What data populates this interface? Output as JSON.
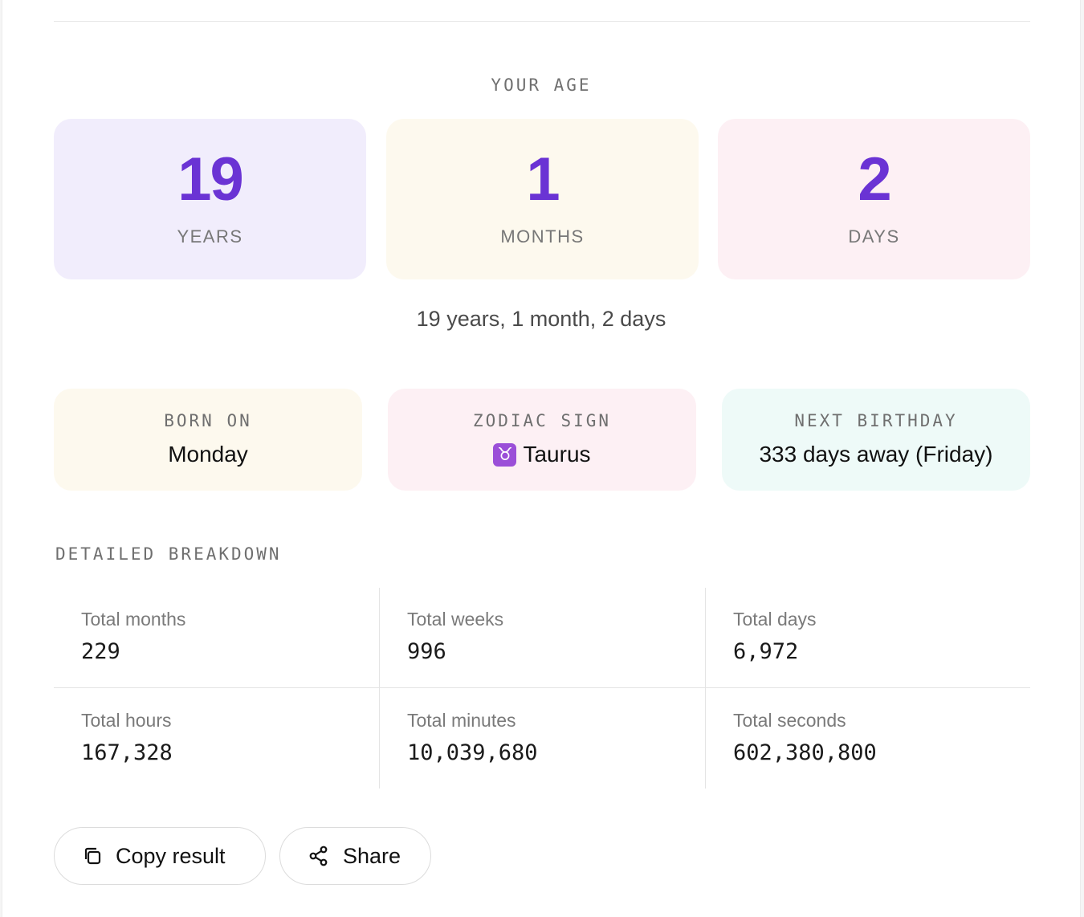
{
  "age_section": {
    "title": "YOUR AGE",
    "tiles": [
      {
        "value": "19",
        "unit": "YEARS",
        "bg": "#f1edfc"
      },
      {
        "value": "1",
        "unit": "MONTHS",
        "bg": "#fdf9ee"
      },
      {
        "value": "2",
        "unit": "DAYS",
        "bg": "#fdf0f4"
      }
    ],
    "summary": "19 years, 1 month, 2 days"
  },
  "info": [
    {
      "label": "BORN ON",
      "value": "Monday",
      "bg": "#fdf9ee"
    },
    {
      "label": "ZODIAC SIGN",
      "icon": "taurus-icon",
      "icon_glyph": "♉",
      "value": "Taurus",
      "bg": "#fdf0f4"
    },
    {
      "label": "NEXT BIRTHDAY",
      "value": "333 days away (Friday)",
      "bg": "#eefaf8"
    }
  ],
  "breakdown": {
    "title": "DETAILED BREAKDOWN",
    "cells": [
      {
        "label": "Total months",
        "value": "229"
      },
      {
        "label": "Total weeks",
        "value": "996"
      },
      {
        "label": "Total days",
        "value": "6,972"
      },
      {
        "label": "Total hours",
        "value": "167,328"
      },
      {
        "label": "Total minutes",
        "value": "10,039,680"
      },
      {
        "label": "Total seconds",
        "value": "602,380,800"
      }
    ]
  },
  "actions": {
    "copy_label": "Copy result",
    "copy_icon": "copy-icon",
    "share_label": "Share",
    "share_icon": "share-icon"
  },
  "colors": {
    "accent": "#6a33d4"
  }
}
